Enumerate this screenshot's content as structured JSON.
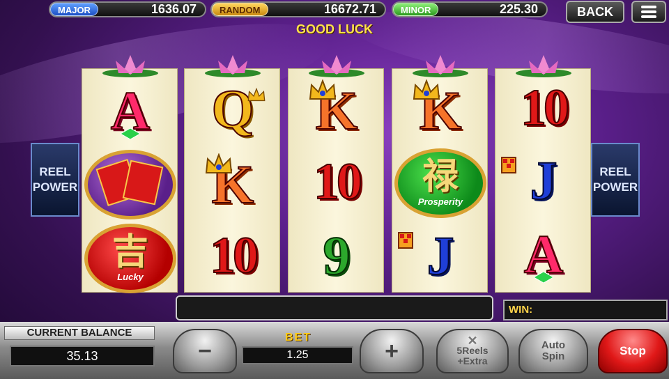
{
  "jackpots": {
    "major": {
      "label": "MAJOR",
      "value": "1636.07"
    },
    "random": {
      "label": "RANDOM",
      "value": "16672.71"
    },
    "minor": {
      "label": "MINOR",
      "value": "225.30"
    }
  },
  "top_buttons": {
    "back_label": "BACK",
    "menu_icon": "menu-icon"
  },
  "status_message": "GOOD LUCK",
  "side_panels": {
    "line1": "REEL",
    "line2": "POWER"
  },
  "reels": [
    [
      {
        "symbol": "A",
        "color": "pink"
      },
      {
        "symbol": "red-envelopes",
        "badge": "purple"
      },
      {
        "symbol": "吉",
        "caption": "Lucky",
        "badge": "red"
      }
    ],
    [
      {
        "symbol": "Q",
        "color": "gold"
      },
      {
        "symbol": "K",
        "color": "orange"
      },
      {
        "symbol": "10",
        "color": "red"
      }
    ],
    [
      {
        "symbol": "K",
        "color": "orange"
      },
      {
        "symbol": "10",
        "color": "red"
      },
      {
        "symbol": "9",
        "color": "green"
      }
    ],
    [
      {
        "symbol": "K",
        "color": "orange"
      },
      {
        "symbol": "禄",
        "caption": "Prosperity",
        "badge": "green"
      },
      {
        "symbol": "J",
        "color": "blue"
      }
    ],
    [
      {
        "symbol": "10",
        "color": "red"
      },
      {
        "symbol": "J",
        "color": "blue"
      },
      {
        "symbol": "A",
        "color": "pink"
      }
    ]
  ],
  "win": {
    "label": "WIN:",
    "value": ""
  },
  "balance": {
    "label": "CURRENT BALANCE",
    "value": "35.13"
  },
  "bet": {
    "label": "BET",
    "value": "1.25"
  },
  "controls": {
    "minus_label": "−",
    "plus_label": "+",
    "extra_line1": "5Reels",
    "extra_line2": "+Extra",
    "autospin_line1": "Auto",
    "autospin_line2": "Spin",
    "stop_label": "Stop"
  },
  "colors": {
    "accent": "#ffe24a",
    "stop": "#e01818",
    "background": "#5a1f8a"
  }
}
